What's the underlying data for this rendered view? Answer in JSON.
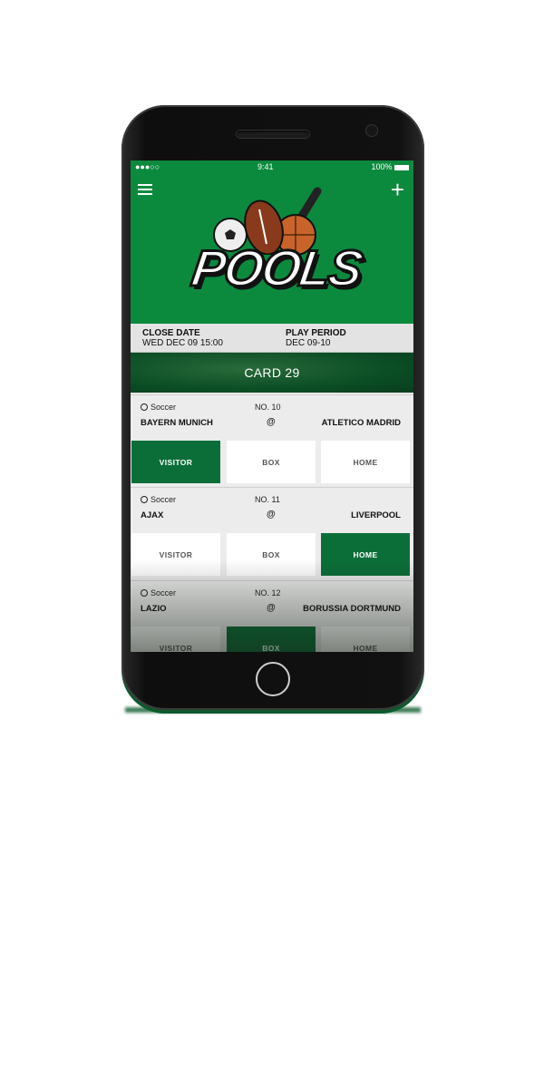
{
  "status": {
    "carrier": "●●●○○",
    "time": "9:41",
    "battery": "100%"
  },
  "header": {
    "logo_text": "POOLS"
  },
  "info": {
    "close_label": "CLOSE DATE",
    "close_value": "WED DEC 09 15:00",
    "play_label": "PLAY PERIOD",
    "play_value": "DEC 09-10"
  },
  "card": {
    "title": "CARD 29"
  },
  "matches": [
    {
      "sport": "Soccer",
      "number": "NO. 10",
      "visitor": "BAYERN MUNICH",
      "at": "@",
      "home": "ATLETICO MADRID",
      "buttons": [
        "VISITOR",
        "BOX",
        "HOME"
      ],
      "selected": "VISITOR"
    },
    {
      "sport": "Soccer",
      "number": "NO. 11",
      "visitor": "AJAX",
      "at": "@",
      "home": "LIVERPOOL",
      "buttons": [
        "VISITOR",
        "BOX",
        "HOME"
      ],
      "selected": "HOME"
    },
    {
      "sport": "Soccer",
      "number": "NO. 12",
      "visitor": "LAZIO",
      "at": "@",
      "home": "BORUSSIA DORTMUND",
      "buttons": [
        "VISITOR",
        "BOX",
        "HOME"
      ],
      "selected": "BOX"
    }
  ],
  "colors": {
    "brand_green": "#0b8a3e",
    "selected_green": "#0b6e38"
  }
}
